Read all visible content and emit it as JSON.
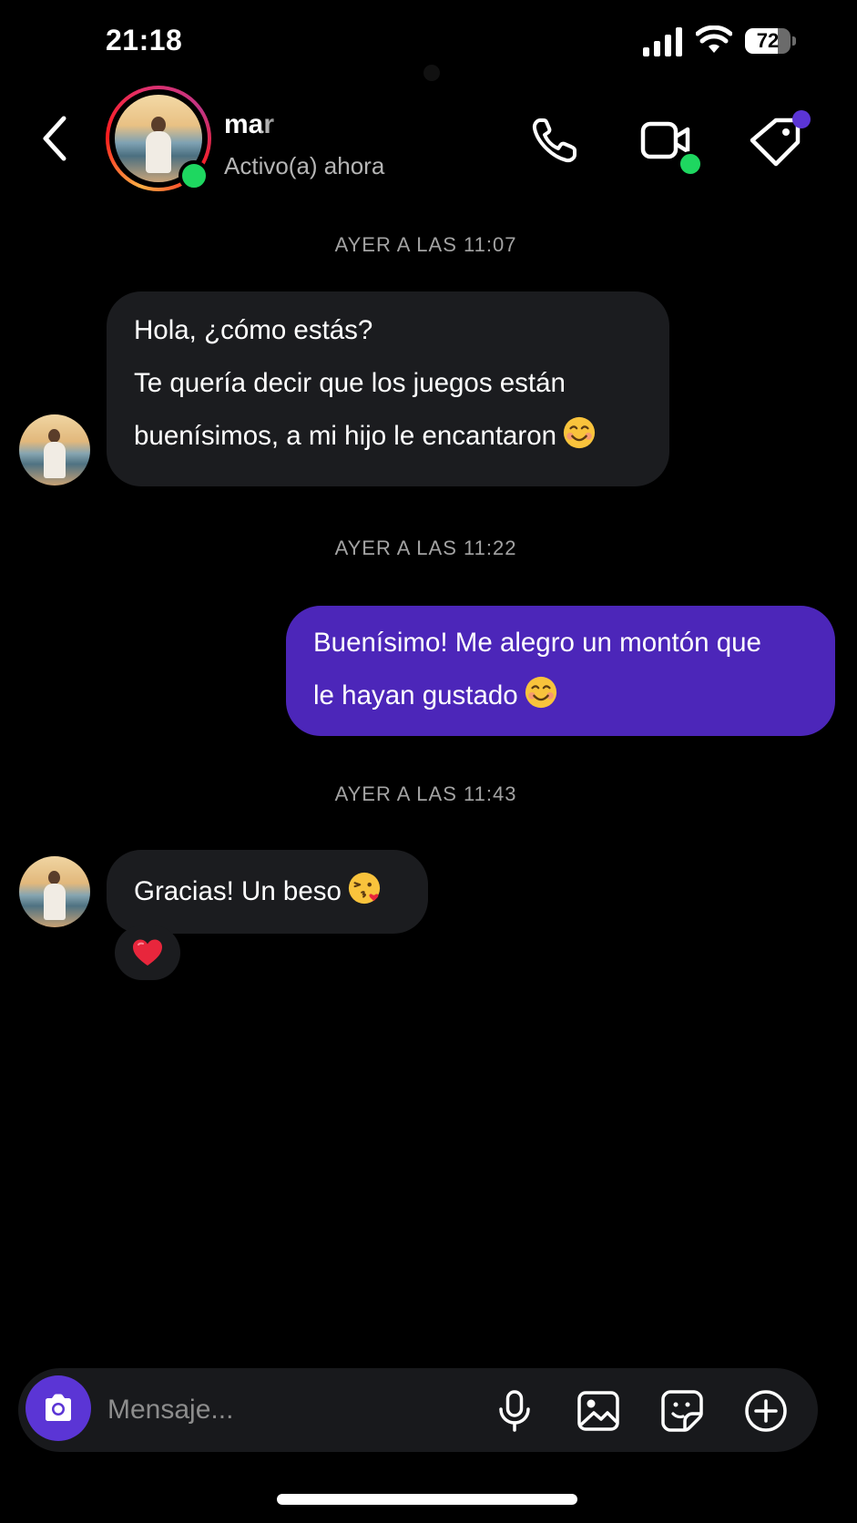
{
  "status_bar": {
    "time": "21:18",
    "battery_level": "72",
    "battery_fraction": 0.72
  },
  "header": {
    "contact_name": "mar",
    "contact_status": "Activo(a) ahora",
    "icons": [
      "back-arrow-icon",
      "phone-icon",
      "video-camera-icon",
      "tag-icon"
    ],
    "online_color": "#1ed760",
    "notification_color": "#5b35d5"
  },
  "conversation": {
    "timestamps": [
      "AYER A LAS 11:07",
      "AYER A LAS 11:22",
      "AYER A LAS 11:43"
    ],
    "messages": [
      {
        "direction": "incoming",
        "lines": [
          "Hola, ¿cómo estás?",
          "Te quería decir que los juegos están",
          "buenísimos, a mi hijo le encantaron"
        ],
        "emoji": "smiling-face-emoji"
      },
      {
        "direction": "outgoing",
        "lines": [
          "Buenísimo! Me alegro un montón que",
          "le hayan gustado"
        ],
        "emoji": "smiling-face-emoji"
      },
      {
        "direction": "incoming",
        "lines": [
          "Gracias! Un beso"
        ],
        "emoji": "face-blowing-kiss-emoji",
        "reaction": "heart-emoji"
      }
    ],
    "outgoing_bubble_color": "#4c26b9",
    "incoming_bubble_color": "#1b1c1f"
  },
  "composer": {
    "placeholder": "Mensaje...",
    "value": "",
    "icons": [
      "camera-icon",
      "microphone-icon",
      "image-icon",
      "sticker-icon",
      "add-circle-icon"
    ],
    "camera_button_color": "#5b35d5"
  }
}
